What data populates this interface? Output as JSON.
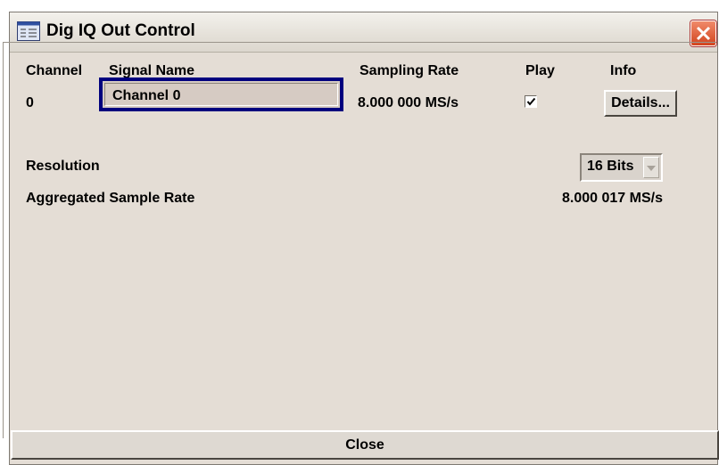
{
  "window": {
    "title": "Dig IQ Out Control"
  },
  "table": {
    "headers": {
      "channel": "Channel",
      "signal_name": "Signal Name",
      "sampling_rate": "Sampling Rate",
      "play": "Play",
      "info": "Info"
    },
    "row": {
      "channel": "0",
      "signal_name": "Channel 0",
      "sampling_rate": "8.000 000 MS/s",
      "play_checked": true,
      "details_label": "Details..."
    }
  },
  "resolution": {
    "label": "Resolution",
    "selected": "16 Bits"
  },
  "aggregated": {
    "label": "Aggregated Sample Rate",
    "value": "8.000 017 MS/s"
  },
  "footer": {
    "close_label": "Close"
  },
  "icons": {
    "app": "window-icon",
    "close": "close-icon",
    "check": "check-icon",
    "dropdown": "chevron-down-icon"
  },
  "colors": {
    "dialog_bg": "#e4ddd5",
    "focus_border": "#00007e",
    "close_accent": "#d2441e"
  }
}
